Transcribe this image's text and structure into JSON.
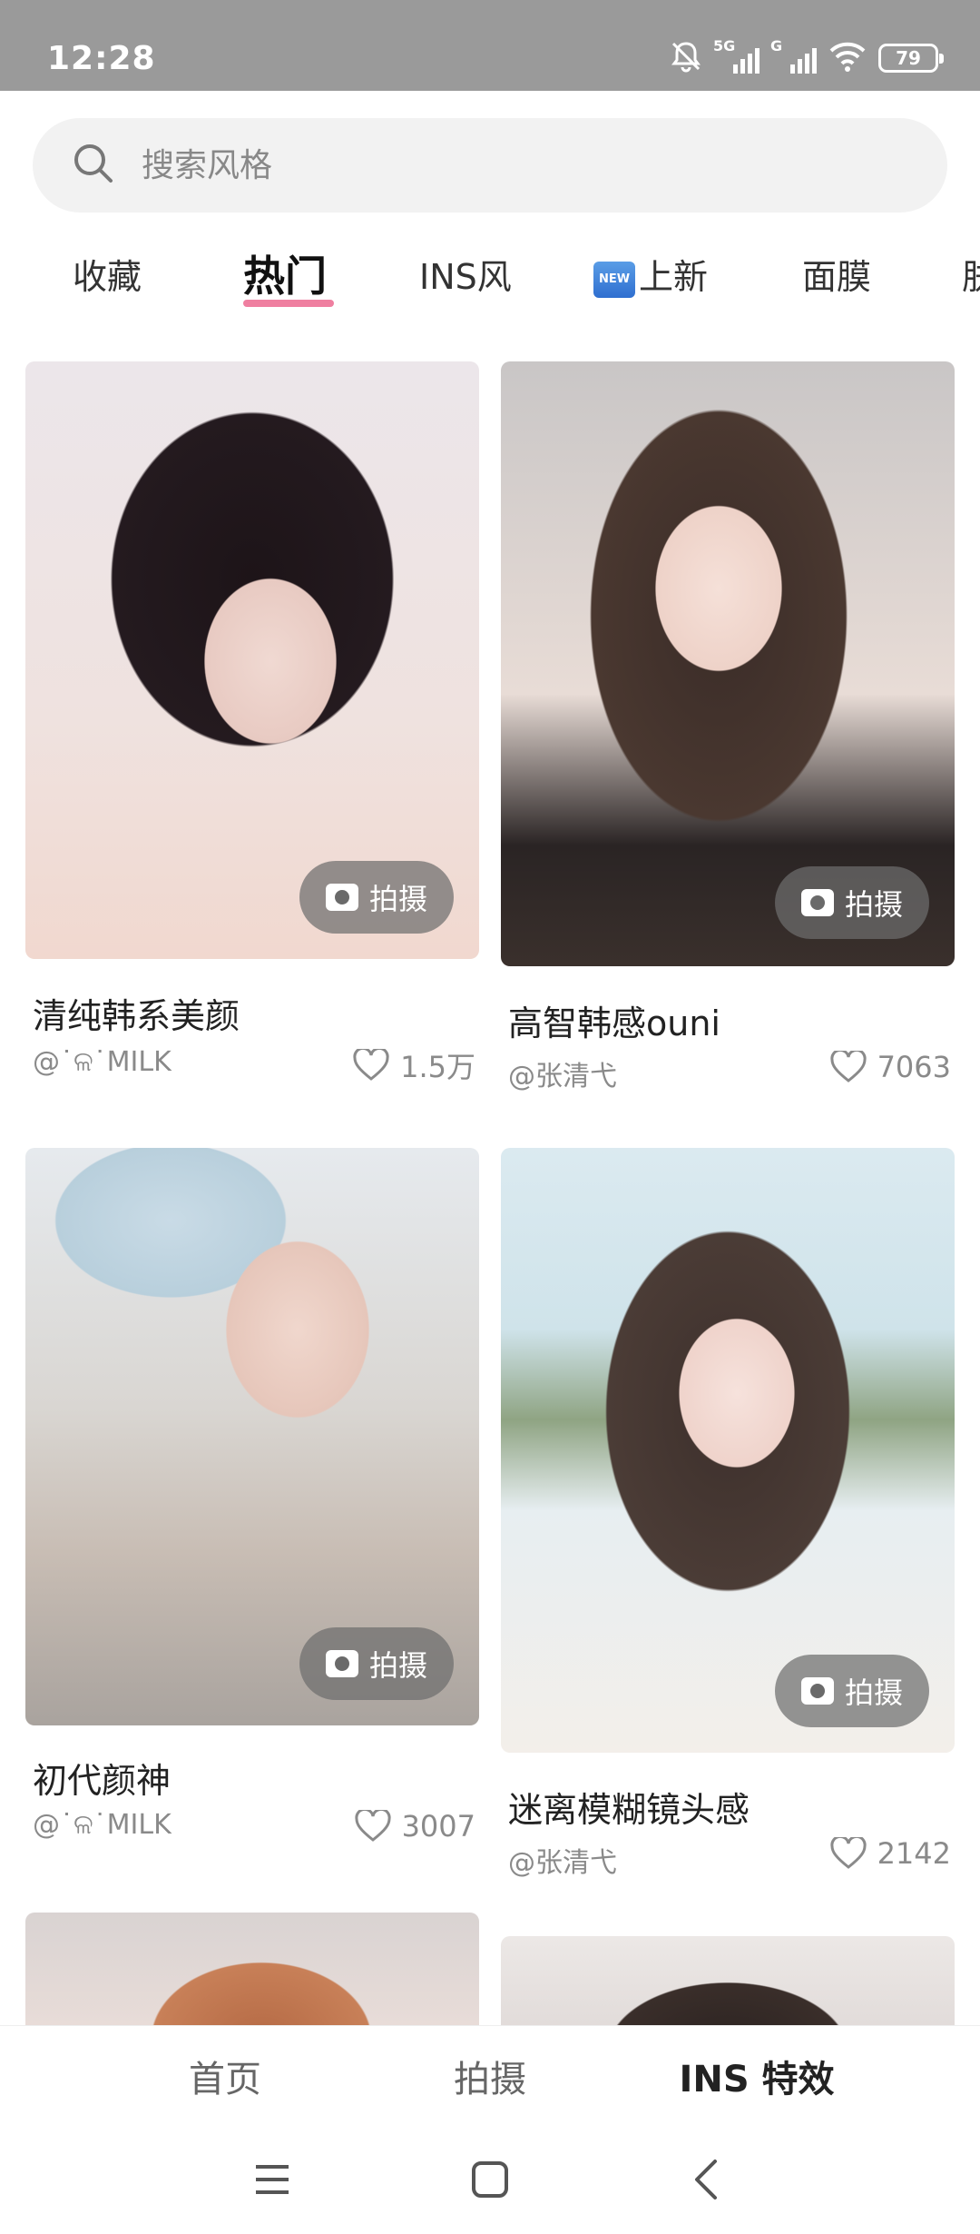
{
  "status_bar": {
    "time": "12:28",
    "battery": "79",
    "net1": "5G",
    "net2": "G"
  },
  "search": {
    "placeholder": "搜索风格"
  },
  "tabs": [
    {
      "label": "收藏"
    },
    {
      "label": "热门",
      "active": true
    },
    {
      "label": "INS风"
    },
    {
      "badge": "NEW",
      "label": "上新"
    },
    {
      "label": "面膜"
    },
    {
      "label": "肤"
    }
  ],
  "cards": [
    {
      "title": "清纯韩系美颜",
      "author": "@˙ଳ˙MILK",
      "likes": "1.5万",
      "shoot_label": "拍摄"
    },
    {
      "title": "高智韩感ouni",
      "author": "@张清弋",
      "likes": "7063",
      "shoot_label": "拍摄"
    },
    {
      "title": "初代颜神",
      "author": "@˙ଳ˙MILK",
      "likes": "3007",
      "shoot_label": "拍摄"
    },
    {
      "title": "迷离模糊镜头感",
      "author": "@张清弋",
      "likes": "2142",
      "shoot_label": "拍摄"
    }
  ],
  "bottom_nav": [
    {
      "label": "首页"
    },
    {
      "label": "拍摄"
    },
    {
      "label": "INS 特效",
      "active": true
    }
  ],
  "icons": {
    "search": "search-icon",
    "camera": "camera-icon",
    "heart": "heart-icon",
    "menu": "menu-icon",
    "home": "home-icon",
    "back": "back-icon",
    "mute": "bell-off-icon",
    "wifi": "wifi-icon"
  },
  "colors": {
    "tab_underline": "#ef7fa0",
    "status_bar": "#9a9a9a"
  }
}
